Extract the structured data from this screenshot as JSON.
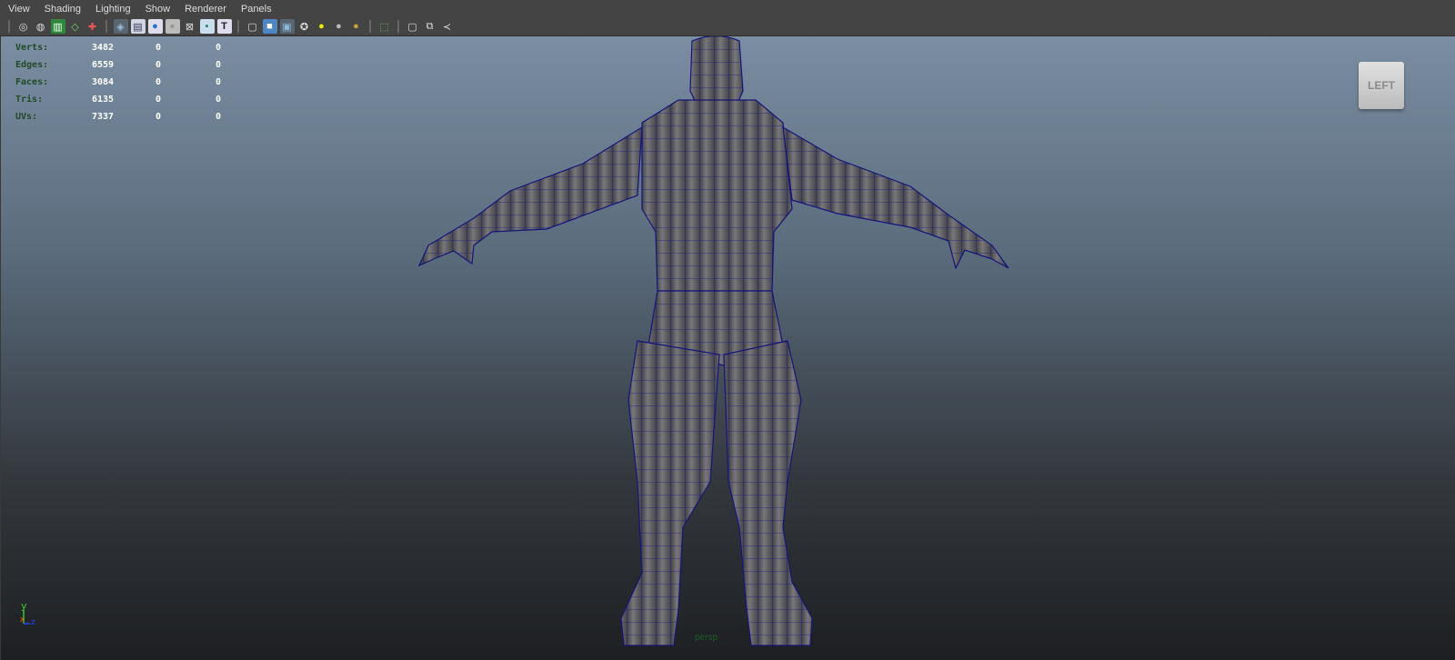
{
  "menubar": {
    "items": [
      "View",
      "Shading",
      "Lighting",
      "Show",
      "Renderer",
      "Panels"
    ]
  },
  "toolbar": {
    "icons": [
      "camera-select-icon",
      "camera-attributes-icon",
      "bookmarks-icon",
      "image-plane-icon",
      "2d-pan-zoom-icon",
      "grid-icon",
      "film-gate-icon",
      "resolution-gate-icon",
      "gate-mask-icon",
      "field-chart-icon",
      "safe-action-icon",
      "safe-title-icon",
      "wireframe-icon",
      "smooth-shade-icon",
      "wireframe-on-shaded-icon",
      "textured-icon",
      "use-all-lights-icon",
      "shadows-icon",
      "ambient-occlusion-icon",
      "isolate-select-icon",
      "xray-icon",
      "xray-active-components-icon",
      "xray-joints-icon"
    ]
  },
  "stats": [
    {
      "label": "Verts:",
      "value": "3482",
      "sel": "0",
      "extra": "0"
    },
    {
      "label": "Edges:",
      "value": "6559",
      "sel": "0",
      "extra": "0"
    },
    {
      "label": "Faces:",
      "value": "3084",
      "sel": "0",
      "extra": "0"
    },
    {
      "label": "Tris:",
      "value": "6135",
      "sel": "0",
      "extra": "0"
    },
    {
      "label": "UVs:",
      "value": "7337",
      "sel": "0",
      "extra": "0"
    }
  ],
  "viewcube": {
    "label": "LEFT"
  },
  "axis": {
    "y": "y",
    "x": "x",
    "z": "z"
  },
  "camera_label": "persp",
  "colors": {
    "wire": "#1a1a8a",
    "mesh": "#6e6e72",
    "stat_label": "#1f4a26"
  }
}
